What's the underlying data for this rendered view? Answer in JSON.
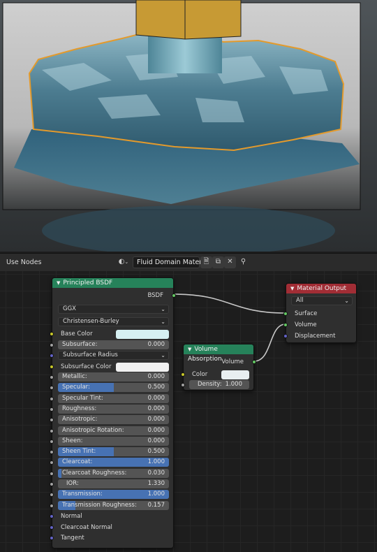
{
  "header": {
    "use_nodes_label": "Use Nodes",
    "material_name": "Fluid Domain Materi...",
    "icons": [
      "material-sphere-icon",
      "chevron-down-icon",
      "browse-icon",
      "duplicate-icon",
      "close-icon",
      "pin-icon"
    ]
  },
  "principled": {
    "title": "Principled BSDF",
    "output": "BSDF",
    "distribution": "GGX",
    "subsurface_method": "Christensen-Burley",
    "base_color_label": "Base Color",
    "base_color": "#d6f0f2",
    "subsurface": {
      "label": "Subsurface:",
      "value": "0.000"
    },
    "subsurface_radius": "Subsurface Radius",
    "subsurface_color_label": "Subsurface Color",
    "subsurface_color": "#f0f0f0",
    "params": [
      {
        "label": "Metallic:",
        "value": "0.000",
        "fill": 0.0
      },
      {
        "label": "Specular:",
        "value": "0.500",
        "fill": 0.5
      },
      {
        "label": "Specular Tint:",
        "value": "0.000",
        "fill": 0.0
      },
      {
        "label": "Roughness:",
        "value": "0.000",
        "fill": 0.0
      },
      {
        "label": "Anisotropic:",
        "value": "0.000",
        "fill": 0.0
      },
      {
        "label": "Anisotropic Rotation:",
        "value": "0.000",
        "fill": 0.0
      },
      {
        "label": "Sheen:",
        "value": "0.000",
        "fill": 0.0
      },
      {
        "label": "Sheen Tint:",
        "value": "0.500",
        "fill": 0.5
      },
      {
        "label": "Clearcoat:",
        "value": "1.000",
        "fill": 1.0
      },
      {
        "label": "Clearcoat Roughness:",
        "value": "0.030",
        "fill": 0.03
      },
      {
        "label": "IOR:",
        "value": "1.330",
        "fill": 0.0
      },
      {
        "label": "Transmission:",
        "value": "1.000",
        "fill": 1.0
      },
      {
        "label": "Transmission Roughness:",
        "value": "0.157",
        "fill": 0.157
      }
    ],
    "vector_inputs": [
      "Normal",
      "Clearcoat Normal",
      "Tangent"
    ]
  },
  "volume": {
    "title": "Volume Absorption",
    "output": "Volume",
    "color_label": "Color",
    "color": "#e8eef0",
    "density_label": "Density:",
    "density_value": "1.000"
  },
  "output": {
    "title": "Material Output",
    "target": "All",
    "inputs": [
      "Surface",
      "Volume",
      "Displacement"
    ]
  },
  "colors": {
    "shader_header": "#26825a",
    "output_header": "#a12d35",
    "slider_fill": "#4772b3",
    "link": "#c8c8c8"
  }
}
